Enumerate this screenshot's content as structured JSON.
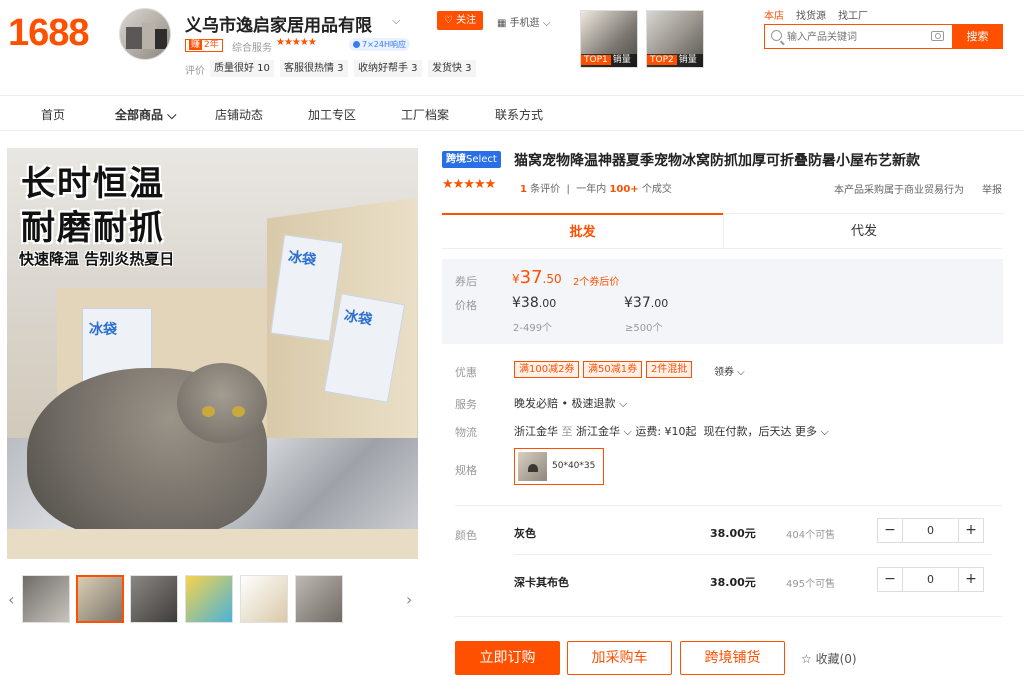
{
  "header": {
    "logo": "1688",
    "shop_name": "义乌市逸启家居用品有限",
    "years_badge_icon": "赚",
    "years_badge": "2年",
    "service_label": "综合服务",
    "service_stars": "★★★★★",
    "response_badge": "7×24H响应",
    "eval_label": "评价",
    "eval_tags": [
      "质量很好 10",
      "客服很热情 3",
      "收纳好帮手 3",
      "发货快 3"
    ],
    "follow_label": "关注",
    "mobile_label": "手机逛",
    "top_products": [
      {
        "rank": "TOP1",
        "tag": "销量"
      },
      {
        "rank": "TOP2",
        "tag": "销量"
      }
    ],
    "search_scopes": [
      "本店",
      "找货源",
      "找工厂"
    ],
    "search_placeholder": "输入产品关键词",
    "search_button": "搜索"
  },
  "nav": {
    "items": [
      "首页",
      "全部商品",
      "店铺动态",
      "加工专区",
      "工厂档案",
      "联系方式"
    ]
  },
  "gallery": {
    "hero_line1": "长时恒温",
    "hero_line2": "耐磨耐抓",
    "hero_sub": "快速降温  告别炎热夏日",
    "pouch_text": "冰袋"
  },
  "product": {
    "badge_prefix": "跨境",
    "badge_suffix": "Select",
    "title": "猫窝宠物降温神器夏季宠物冰窝防抓加厚可折叠防暑小屋布艺新款",
    "stars": "★★★★★",
    "review_count": "1",
    "review_label": "条评价",
    "sales_period": "一年内",
    "sales_count": "100+",
    "sales_label": "个成交",
    "trade_note": "本产品采购属于商业贸易行为",
    "report": "举报"
  },
  "tabs": [
    "批发",
    "代发"
  ],
  "price": {
    "coupon_label": "券后",
    "coupon_currency": "¥",
    "coupon_int": "37",
    "coupon_dec": ".50",
    "coupon_note": "2个券后价",
    "price_label": "价格",
    "tiers": [
      {
        "int": "¥38",
        "dec": ".00",
        "qty": "2-499个"
      },
      {
        "int": "¥37",
        "dec": ".00",
        "qty": "≥500个"
      }
    ]
  },
  "details": {
    "promo_label": "优惠",
    "promos": [
      "满100减2券",
      "满50减1券",
      "2件混批"
    ],
    "coupon_dropdown": "领券",
    "service_label": "服务",
    "service_value": "晚发必赔 • 极速退款",
    "logistics_label": "物流",
    "logistics_from": "浙江金华",
    "logistics_to_word": "至",
    "logistics_to": "浙江金华",
    "logistics_fee": "运费: ¥10起",
    "logistics_time": "现在付款，后天达",
    "logistics_more": "更多",
    "spec_label": "规格",
    "spec_value": "50*40*35",
    "color_label": "颜色",
    "colors": [
      {
        "name": "灰色",
        "price": "38.00元",
        "stock": "404个可售",
        "qty": "0"
      },
      {
        "name": "深卡其布色",
        "price": "38.00元",
        "stock": "495个可售",
        "qty": "0"
      }
    ]
  },
  "actions": {
    "order": "立即订购",
    "cart": "加采购车",
    "crossborder": "跨境铺货",
    "favorite": "收藏(0)"
  }
}
